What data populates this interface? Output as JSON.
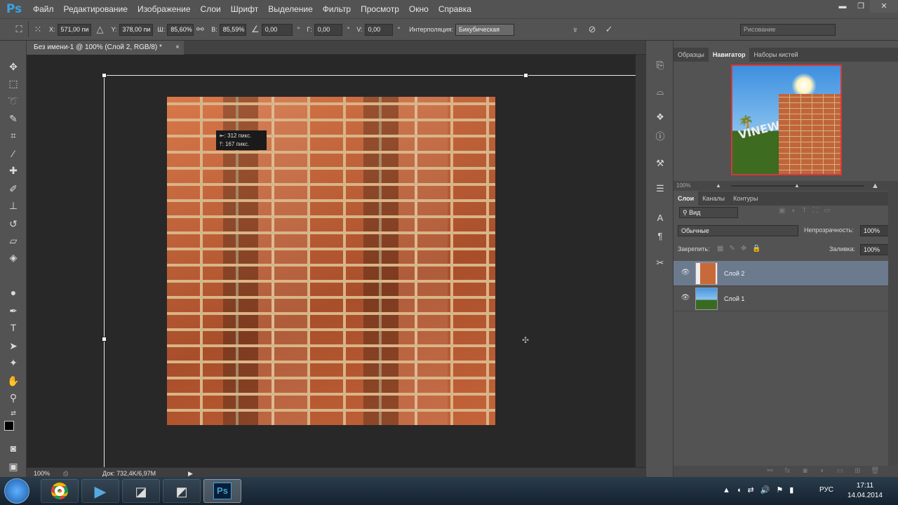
{
  "app": {
    "logo": "Ps"
  },
  "menu": {
    "items": [
      "Файл",
      "Редактирование",
      "Изображение",
      "Слои",
      "Шрифт",
      "Выделение",
      "Фильтр",
      "Просмотр",
      "Окно",
      "Справка"
    ]
  },
  "window_controls": {
    "minimize": "▬",
    "restore": "❐",
    "close": "✕"
  },
  "options_bar": {
    "x_label": "X:",
    "x_value": "571,00 пи",
    "y_label": "Y:",
    "y_value": "378,00 пи",
    "w_label": "Ш:",
    "w_value": "85,60%",
    "h_label": "В:",
    "h_value": "85,59%",
    "angle_value": "0,00",
    "angle_unit": "°",
    "hskew_label": "Г:",
    "hskew_value": "0,00",
    "hskew_unit": "°",
    "vskew_label": "V:",
    "vskew_value": "0,00",
    "vskew_unit": "°",
    "interp_label": "Интерполяция:",
    "interp_value": "Бикубическая",
    "workspace": "Рисование"
  },
  "document": {
    "tab_title": "Без имени-1 @ 100% (Слой 2, RGB/8) *",
    "tab_close": "×",
    "tooltip_line1": "⇤: 312 пикс.",
    "tooltip_line2": "⤒: 167 пикс."
  },
  "status": {
    "zoom": "100%",
    "doc_info": "Док: 732,4K/6,97M"
  },
  "nav_panel": {
    "tabs": [
      "Образцы",
      "Навигатор",
      "Наборы кистей"
    ],
    "active_tab": 1,
    "zoom": "100%",
    "thumb_text": "VINEW"
  },
  "layers_panel": {
    "tabs": [
      "Слои",
      "Каналы",
      "Контуры"
    ],
    "active_tab": 0,
    "filter_placeholder": "Вид",
    "blend_mode": "Обычные",
    "opacity_label": "Непрозрачность:",
    "opacity_value": "100%",
    "lock_label": "Закрепить:",
    "fill_label": "Заливка:",
    "fill_value": "100%",
    "layers": [
      {
        "name": "Слой 2",
        "selected": true
      },
      {
        "name": "Слой 1",
        "selected": false
      }
    ]
  },
  "taskbar": {
    "lang": "РУС",
    "time": "17:11",
    "date": "14.04.2014",
    "ps_label": "Ps"
  }
}
